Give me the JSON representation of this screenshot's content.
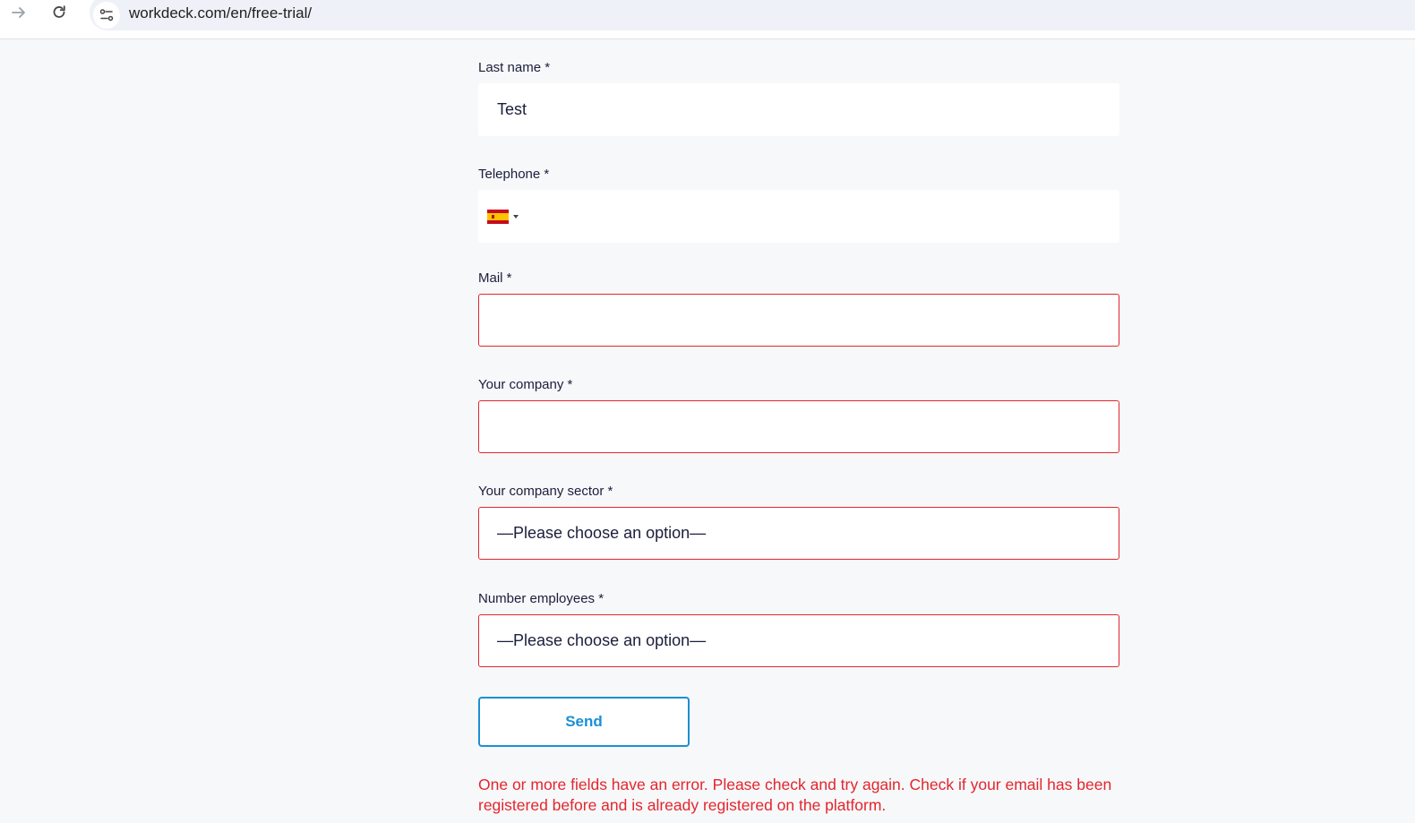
{
  "browser": {
    "url": "workdeck.com/en/free-trial/"
  },
  "form": {
    "last_name": {
      "label": "Last name *",
      "value": "Test"
    },
    "telephone": {
      "label": "Telephone *",
      "value": "",
      "country": "Spain"
    },
    "mail": {
      "label": "Mail *",
      "value": ""
    },
    "company": {
      "label": "Your company *",
      "value": ""
    },
    "sector": {
      "label": "Your company sector *",
      "selected": "—Please choose an option—"
    },
    "employees": {
      "label": "Number employees *",
      "selected": "—Please choose an option—"
    },
    "send_label": "Send",
    "error_message": "One or more fields have an error. Please check and try again. Check if your email has been registered before and is already registered on the platform."
  },
  "colors": {
    "error": "#e3262d",
    "accent": "#1a8fd6",
    "text": "#1b1e3b",
    "background": "#f7f8fa"
  }
}
